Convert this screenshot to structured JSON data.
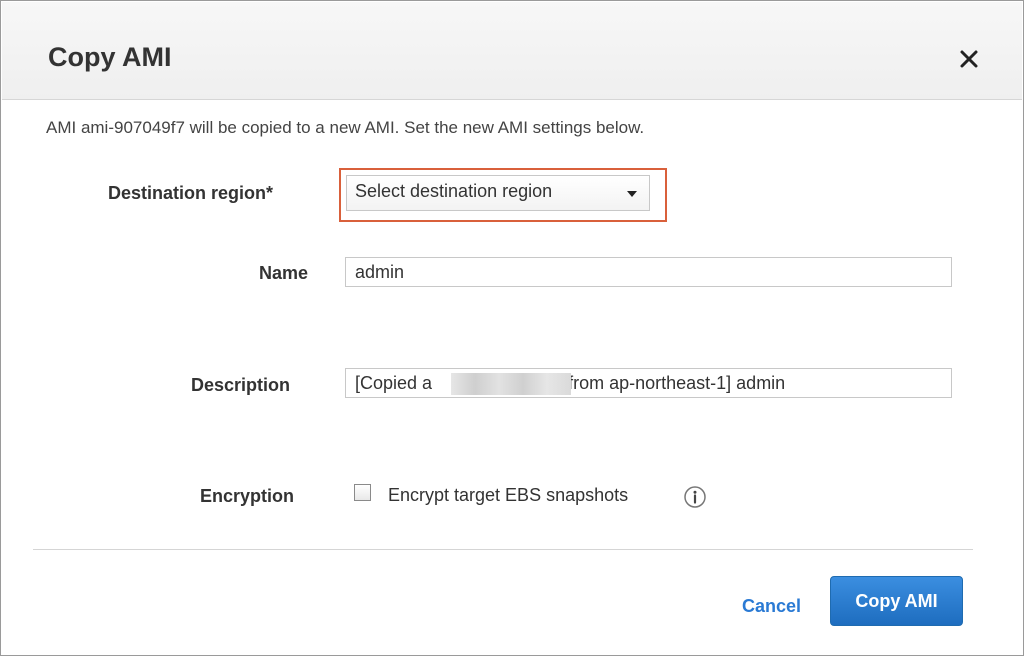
{
  "dialog": {
    "title": "Copy AMI",
    "intro": "AMI ami-907049f7 will be copied to a new AMI. Set the new AMI settings below.",
    "close_icon": "close-icon"
  },
  "form": {
    "destination_region": {
      "label": "Destination region*",
      "value": "Select destination region"
    },
    "name": {
      "label": "Name",
      "value": "admin"
    },
    "description": {
      "label": "Description",
      "value_prefix": "[Copied a",
      "value_suffix": "from ap-northeast-1] admin"
    },
    "encryption": {
      "label": "Encryption",
      "checkbox_label": "Encrypt target EBS snapshots",
      "checked": false,
      "info_icon": "info-icon"
    }
  },
  "footer": {
    "cancel_label": "Cancel",
    "primary_label": "Copy AMI"
  },
  "colors": {
    "primary": "#2a7ad4",
    "highlight": "#d9603b"
  }
}
